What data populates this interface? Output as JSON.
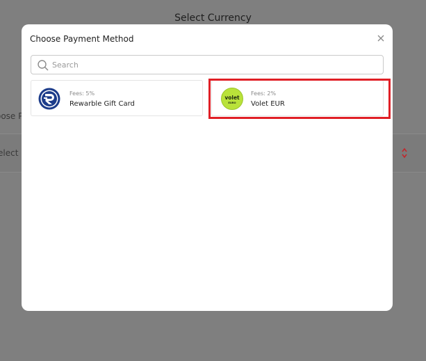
{
  "background": {
    "title": "Select Currency",
    "label": "oose P",
    "select_placeholder": "elect P"
  },
  "modal": {
    "title": "Choose Payment Method",
    "close_icon": "close-icon",
    "search": {
      "placeholder": "Search",
      "value": "",
      "icon": "search-icon"
    },
    "methods": [
      {
        "fee": "Fees: 5%",
        "name": "Rewarble Gift Card",
        "logo": "rewarble-logo",
        "logo_color": "#1c3c8a"
      },
      {
        "fee": "Fees: 2%",
        "name": "Volet EUR",
        "logo": "volet-logo",
        "logo_color": "#b9e23a"
      }
    ]
  },
  "colors": {
    "overlay": "#7f7f7f",
    "highlight": "#e01f26",
    "chevron": "#c0282d"
  }
}
